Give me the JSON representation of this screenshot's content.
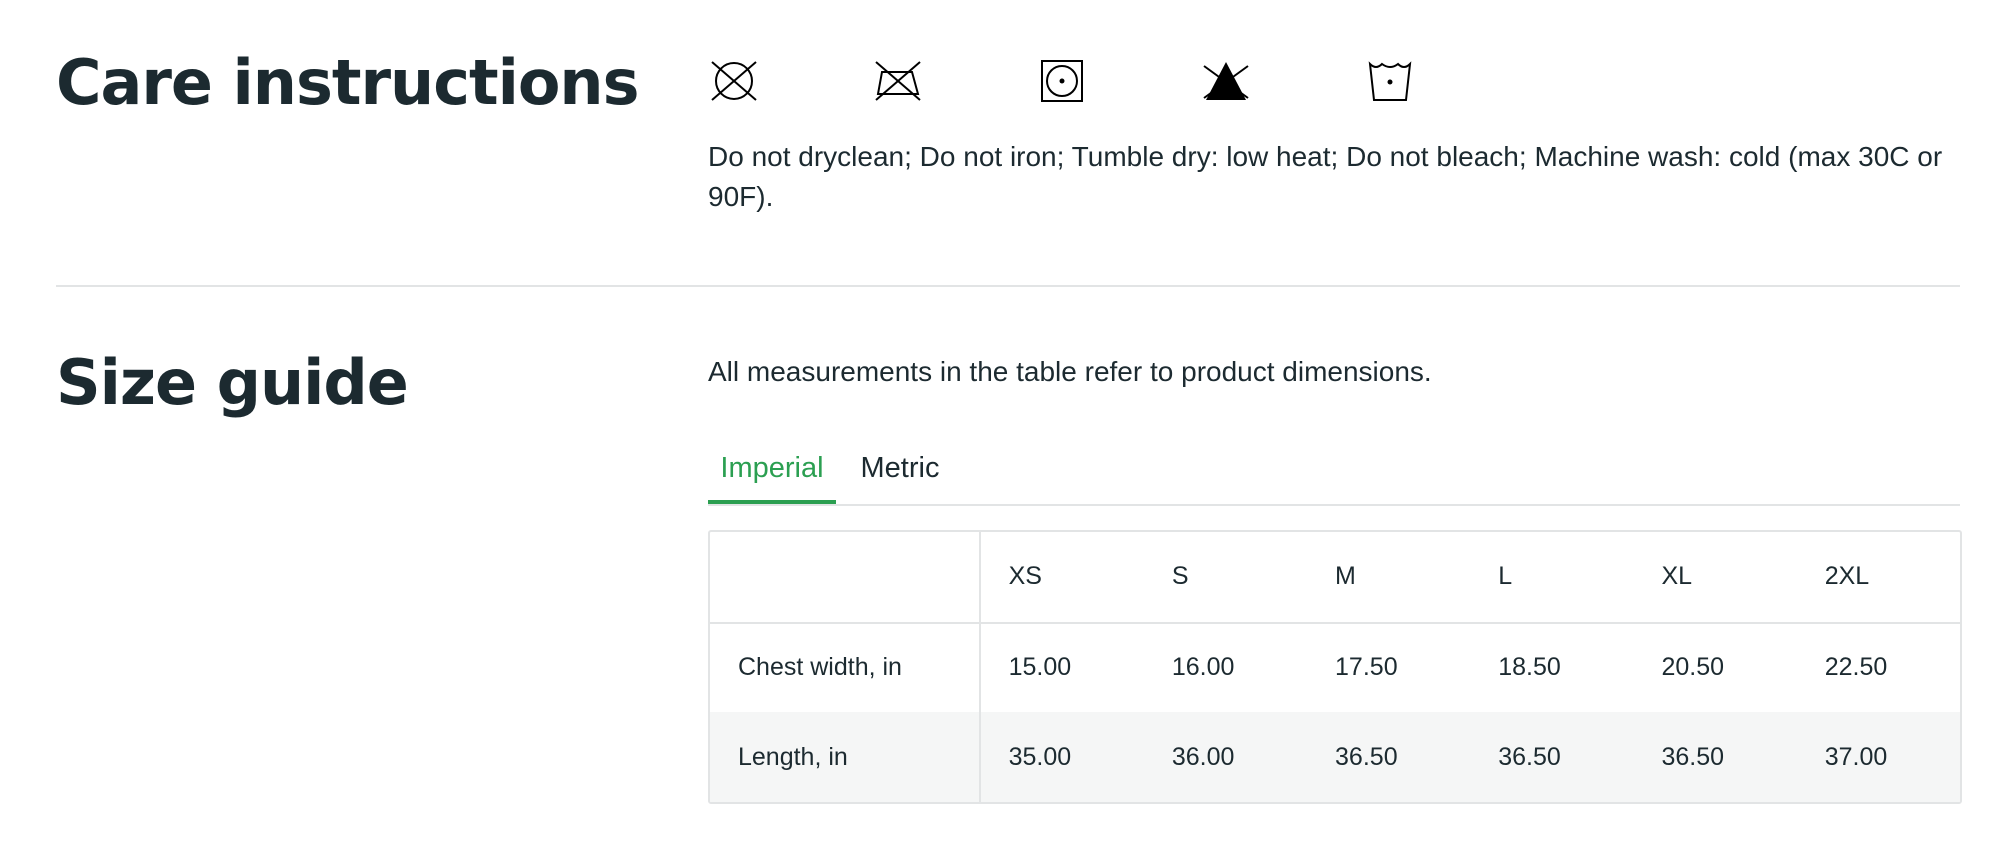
{
  "care": {
    "heading": "Care instructions",
    "icons": [
      "do-not-dryclean-icon",
      "do-not-iron-icon",
      "tumble-dry-low-icon",
      "do-not-bleach-icon",
      "machine-wash-cold-icon"
    ],
    "text": "Do not dryclean; Do not iron; Tumble dry: low heat; Do not bleach; Machine wash: cold (max 30C or 90F)."
  },
  "size": {
    "heading": "Size guide",
    "note": "All measurements in the table refer to product dimensions.",
    "tabs": [
      {
        "label": "Imperial",
        "active": true
      },
      {
        "label": "Metric",
        "active": false
      }
    ],
    "columns": [
      "XS",
      "S",
      "M",
      "L",
      "XL",
      "2XL"
    ],
    "rows": [
      {
        "label": "Chest width, in",
        "values": [
          "15.00",
          "16.00",
          "17.50",
          "18.50",
          "20.50",
          "22.50"
        ]
      },
      {
        "label": "Length, in",
        "values": [
          "35.00",
          "36.00",
          "36.50",
          "36.50",
          "36.50",
          "37.00"
        ]
      }
    ]
  },
  "colors": {
    "accent": "#2b9f51",
    "text": "#1c2a30",
    "border": "#e2e4e5",
    "row_alt": "#f5f6f6"
  }
}
